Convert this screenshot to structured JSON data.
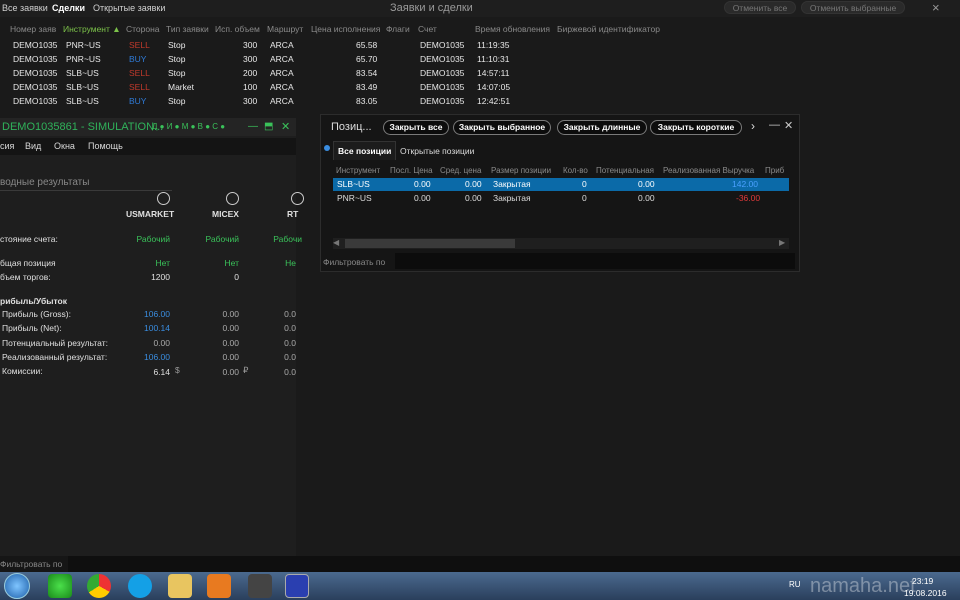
{
  "top": {
    "tabs": [
      "Все заявки",
      "Сделки",
      "Открытые заявки"
    ],
    "window_title": "Заявки и сделки",
    "cancel_all": "Отменить все",
    "cancel_selected": "Отменить выбранные",
    "close_glyph": "×"
  },
  "orders": {
    "columns": [
      "Номер заяв",
      "Инструмент ▲",
      "Сторона",
      "Тип заявки",
      "Исп. объем",
      "Маршрут",
      "Цена исполнения",
      "Флаги",
      "Счет",
      "Время обновления",
      "Биржевой идентификатор"
    ],
    "rows": [
      {
        "num": "DEMO1035",
        "inst": "PNR~US",
        "side": "SELL",
        "type": "Stop",
        "vol": "300",
        "route": "ARCA",
        "price": "65.58",
        "acct": "DEMO1035",
        "time": "11:19:35"
      },
      {
        "num": "DEMO1035",
        "inst": "PNR~US",
        "side": "BUY",
        "type": "Stop",
        "vol": "300",
        "route": "ARCA",
        "price": "65.70",
        "acct": "DEMO1035",
        "time": "11:10:31"
      },
      {
        "num": "DEMO1035",
        "inst": "SLB~US",
        "side": "SELL",
        "type": "Stop",
        "vol": "200",
        "route": "ARCA",
        "price": "83.54",
        "acct": "DEMO1035",
        "time": "14:57:11"
      },
      {
        "num": "DEMO1035",
        "inst": "SLB~US",
        "side": "SELL",
        "type": "Market",
        "vol": "100",
        "route": "ARCA",
        "price": "83.49",
        "acct": "DEMO1035",
        "time": "14:07:05"
      },
      {
        "num": "DEMO1035",
        "inst": "SLB~US",
        "side": "BUY",
        "type": "Stop",
        "vol": "300",
        "route": "ARCA",
        "price": "83.05",
        "acct": "DEMO1035",
        "time": "12:42:51"
      }
    ],
    "filter_label": "Фильтровать по"
  },
  "monitor": {
    "title": "DEMO1035861 - SIMULATION...",
    "title_icons": "Д ● И ● М ● В ● С ●",
    "menu": [
      "сия",
      "Вид",
      "Окна",
      "Помощь"
    ],
    "section": "водные результаты",
    "markets": [
      "USMARKET",
      "MICEX",
      "RT"
    ],
    "rows": [
      {
        "label": "стояние счета:",
        "vals": [
          "Рабочий",
          "Рабочий",
          "Рабочи"
        ]
      },
      {
        "label": "бщая позиция",
        "vals": [
          "Нет",
          "Нет",
          "Не"
        ]
      },
      {
        "label": "бъем торгов:",
        "vals": [
          "1200",
          "0",
          ""
        ]
      }
    ],
    "pl_title": "рибыль/Убыток",
    "pl_rows": [
      {
        "label": "Прибыль (Gross):",
        "vals": [
          "106.00",
          "0.00",
          "0.0"
        ]
      },
      {
        "label": "Прибыль (Net):",
        "vals": [
          "100.14",
          "0.00",
          "0.0"
        ]
      },
      {
        "label": "Потенциальный результат:",
        "vals": [
          "0.00",
          "0.00",
          "0.0"
        ]
      },
      {
        "label": "Реализованный результат:",
        "vals": [
          "106.00",
          "0.00",
          "0.0"
        ]
      },
      {
        "label": "Комиссии:",
        "vals": [
          "6.14",
          "0.00",
          "0.0"
        ]
      }
    ],
    "currency": [
      "$",
      "₽"
    ]
  },
  "positions": {
    "title": "Позиц...",
    "buttons": [
      "Закрыть все",
      "Закрыть выбранное",
      "Закрыть длинные",
      "Закрыть короткие"
    ],
    "more": "›",
    "tabs": [
      "Все позиции",
      "Открытые позиции"
    ],
    "columns": [
      "Инструмент",
      "Посл. Цена",
      "Сред. цена",
      "Размер позиции",
      "Кол-во",
      "Потенциальная",
      "Реализованная Выручка",
      "Приб"
    ],
    "rows": [
      {
        "inst": "SLB~US",
        "last": "0.00",
        "avg": "0.00",
        "size": "Закрытая",
        "qty": "0",
        "pot": "0.00",
        "real": "142.00"
      },
      {
        "inst": "PNR~US",
        "last": "0.00",
        "avg": "0.00",
        "size": "Закрытая",
        "qty": "0",
        "pot": "0.00",
        "real": "-36.00"
      }
    ],
    "filter_label": "Фильтровать по"
  },
  "taskbar": {
    "lang": "RU",
    "time": "23:19",
    "date": "19.08.2016",
    "watermark": "namaha.net"
  }
}
